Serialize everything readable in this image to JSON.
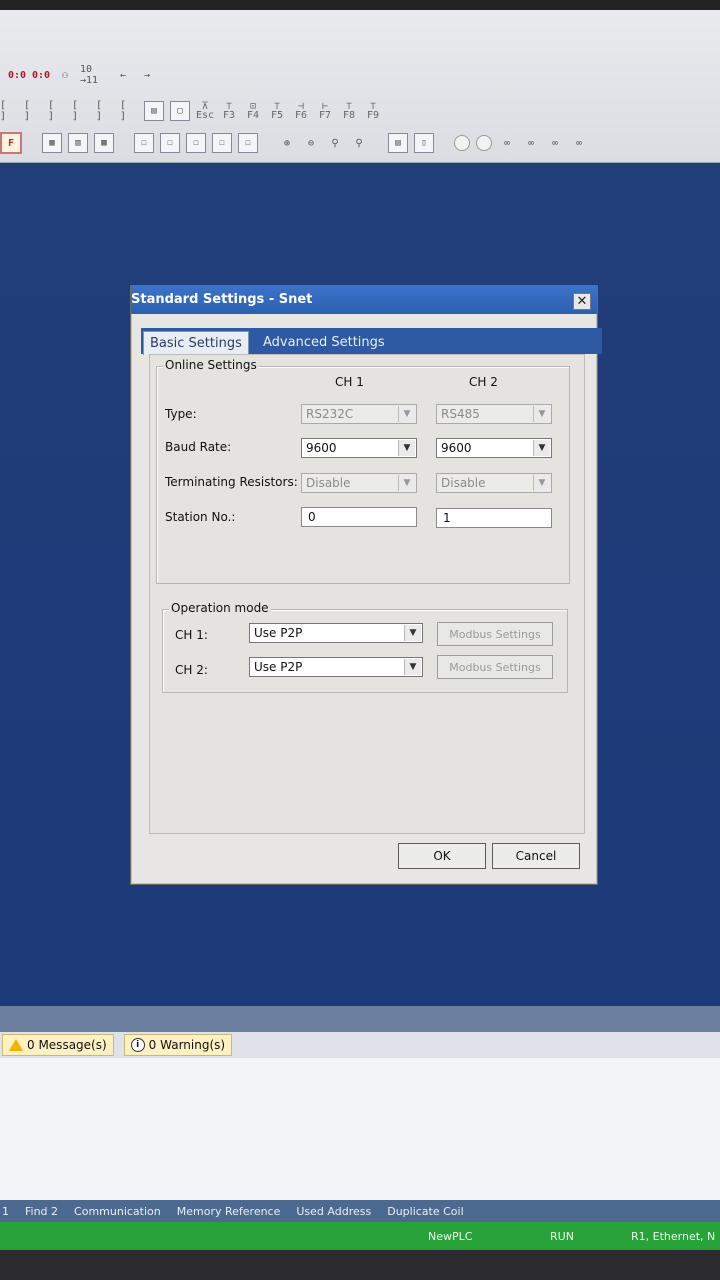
{
  "toolbar": {
    "row1": [
      "0:0",
      "0:0",
      "10 →11",
      "←",
      "→"
    ],
    "row2_brackets": [
      "[ ]",
      "[ ]",
      "[ ]",
      "[ ]",
      "[ ]",
      "[ ]"
    ],
    "fkeys": [
      "Esc",
      "F3",
      "F4",
      "F5",
      "F6",
      "F7",
      "F8",
      "F9"
    ],
    "f_button": "F"
  },
  "dialog": {
    "title": "Standard Settings - Snet",
    "close_symbol": "✕",
    "tabs": [
      {
        "label": "Basic Settings",
        "active": true
      },
      {
        "label": "Advanced Settings",
        "active": false
      }
    ],
    "online": {
      "legend": "Online Settings",
      "ch1_header": "CH 1",
      "ch2_header": "CH 2",
      "type_label": "Type:",
      "baud_label": "Baud Rate:",
      "term_label": "Terminating Resistors:",
      "station_label": "Station No.:",
      "ch1": {
        "type": "RS232C",
        "baud": "9600",
        "term": "Disable",
        "station": "0"
      },
      "ch2": {
        "type": "RS485",
        "baud": "9600",
        "term": "Disable",
        "station": "1"
      }
    },
    "operation": {
      "legend": "Operation mode",
      "ch1_label": "CH 1:",
      "ch2_label": "CH 2:",
      "ch1_value": "Use P2P",
      "ch2_value": "Use P2P",
      "modbus_label": "Modbus Settings"
    },
    "ok_label": "OK",
    "cancel_label": "Cancel"
  },
  "messages": {
    "messages_label": "0 Message(s)",
    "warnings_label": "0 Warning(s)"
  },
  "bottom_tabs": [
    "1",
    "Find 2",
    "Communication",
    "Memory Reference",
    "Used Address",
    "Duplicate Coil"
  ],
  "status": {
    "project": "NewPLC",
    "mode": "RUN",
    "connection": "R1, Ethernet, N"
  },
  "colors": {
    "workspace": "#1c3a78",
    "titlebar": "#2b5fb0",
    "statusbar": "#27a33a"
  }
}
